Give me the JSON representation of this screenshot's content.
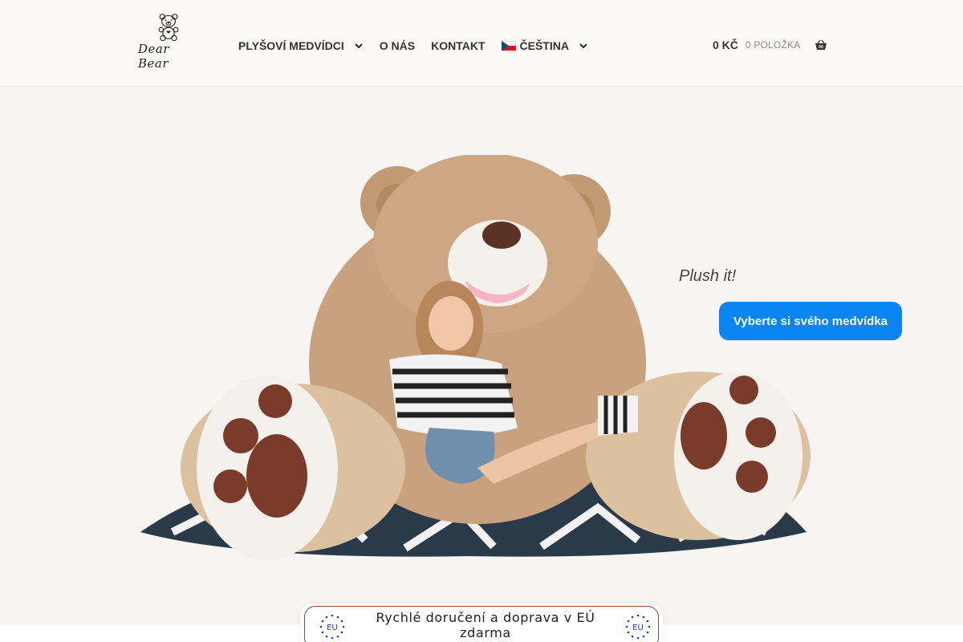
{
  "brand": {
    "logo_text": "Dear Bear"
  },
  "nav": {
    "items": [
      {
        "label": "PLYŠOVÍ MEDVÍDCI",
        "has_dropdown": true
      },
      {
        "label": "O NÁS",
        "has_dropdown": false
      },
      {
        "label": "KONTAKT",
        "has_dropdown": false
      },
      {
        "label": "ČEŠTINA",
        "has_dropdown": true,
        "icon": "czech-flag-icon"
      }
    ]
  },
  "cart": {
    "amount": "0 KČ",
    "count": "0 POLOŽKA",
    "icon": "basket-icon"
  },
  "hero": {
    "tagline": "Plush it!",
    "cta_label": "Vyberte si svého medvídka"
  },
  "badge": {
    "text": "Rychlé doručení a doprava v EÚ zdarma",
    "left_seal": "EU",
    "right_seal": "EU"
  },
  "colors": {
    "accent": "#0a84f0",
    "header_bg": "#fbfaf9",
    "hero_bg": "#f7f5f2",
    "badge_border": "#8b4a3a",
    "eu_star": "#1a3fb0"
  }
}
